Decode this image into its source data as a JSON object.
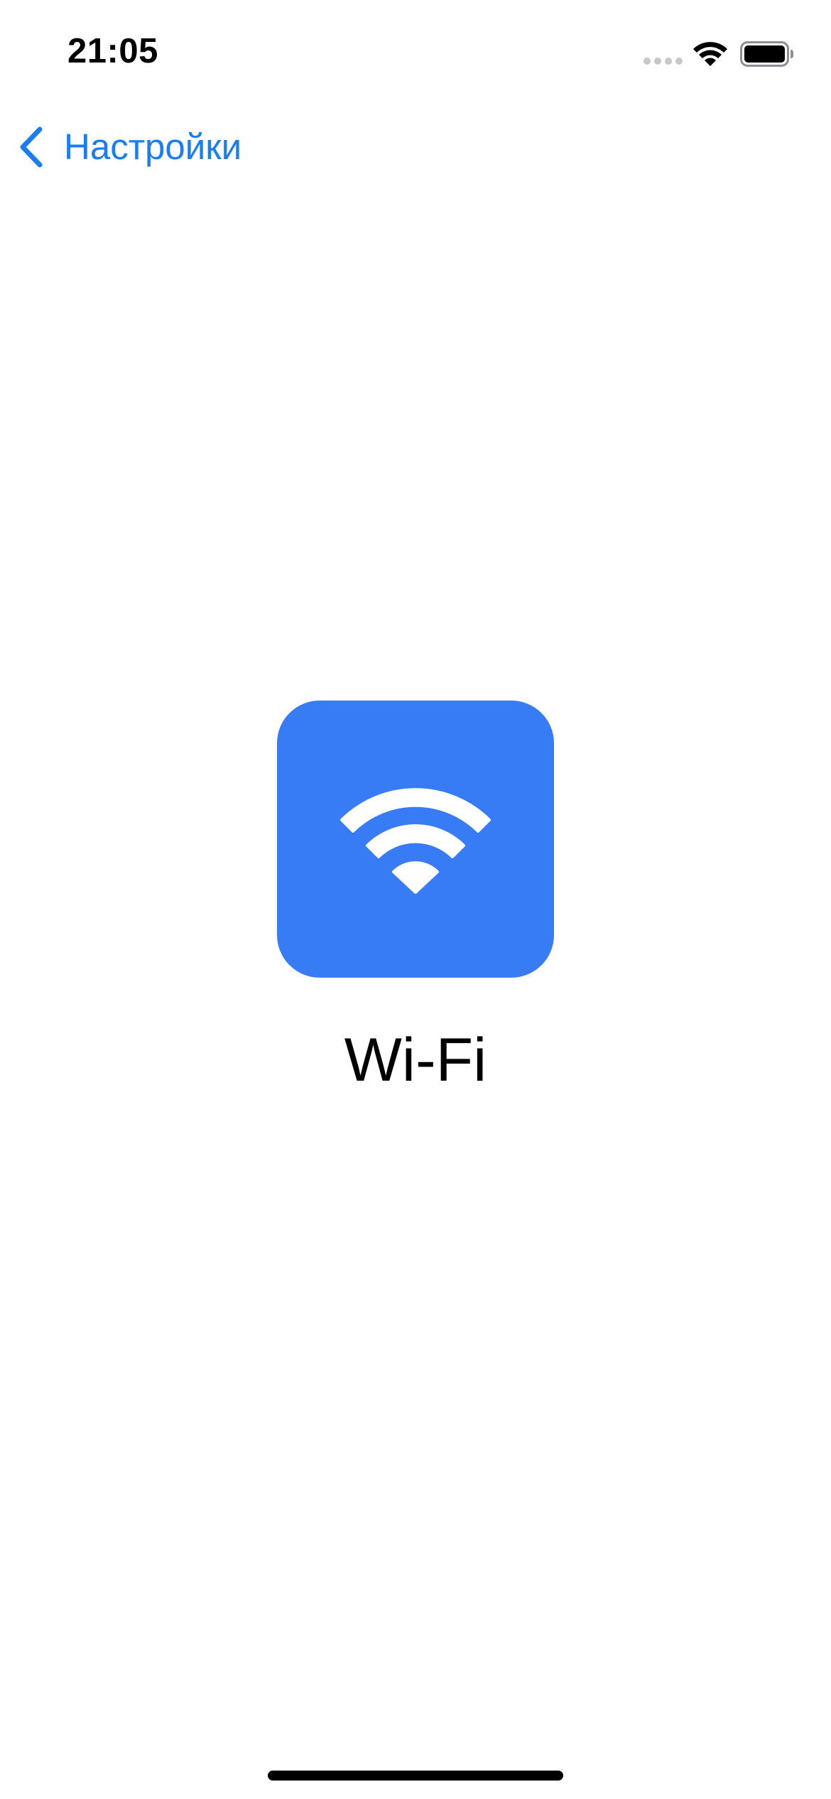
{
  "status_bar": {
    "time": "21:05",
    "icons": [
      "cellular-signal-icon",
      "wifi-icon",
      "battery-icon"
    ]
  },
  "nav": {
    "back_label": "Настройки",
    "back_icon": "chevron-left-icon"
  },
  "main": {
    "icon": "wifi-icon",
    "title": "Wi-Fi"
  },
  "colors": {
    "accent": "#1a7ef2",
    "icon_background": "#377cf5",
    "background": "#ffffff",
    "text": "#000000"
  }
}
